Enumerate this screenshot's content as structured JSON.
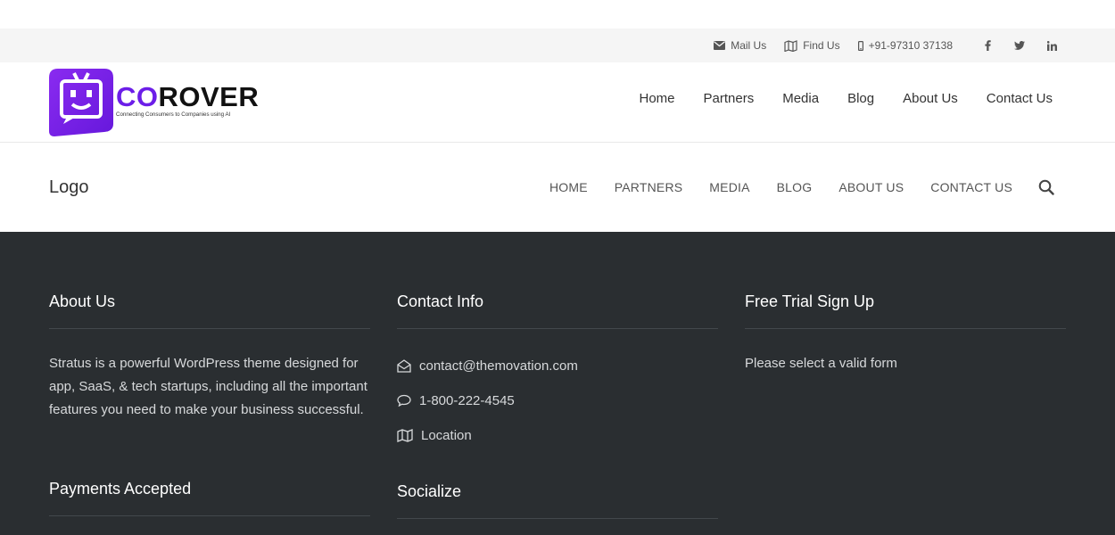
{
  "topbar": {
    "mail_label": "Mail Us",
    "find_label": "Find Us",
    "phone_label": "+91-97310 37138",
    "social": [
      "f",
      "twitter",
      "in"
    ]
  },
  "header1": {
    "logo_co": "CO",
    "logo_rover": "ROVER",
    "logo_tagline": "Connecting Consumers to Companies using AI",
    "nav": [
      "Home",
      "Partners",
      "Media",
      "Blog",
      "About Us",
      "Contact Us"
    ]
  },
  "header2": {
    "logo": "Logo",
    "nav": [
      "HOME",
      "PARTNERS",
      "MEDIA",
      "BLOG",
      "ABOUT US",
      "CONTACT US"
    ]
  },
  "footer": {
    "about": {
      "title": "About Us",
      "text": "Stratus is a powerful WordPress theme designed for app, SaaS, & tech startups, including all the important features you need to make your business successful."
    },
    "contact": {
      "title": "Contact Info",
      "email": "contact@themovation.com",
      "phone": "1-800-222-4545",
      "location": "Location"
    },
    "trial": {
      "title": "Free Trial Sign Up",
      "text": "Please select a valid form"
    },
    "payments": {
      "title": "Payments Accepted"
    },
    "socialize": {
      "title": "Socialize"
    }
  },
  "colors": {
    "brand": "#6c1ee8",
    "footer_bg": "#2a2e31",
    "topbar_bg": "#f5f5f5"
  }
}
